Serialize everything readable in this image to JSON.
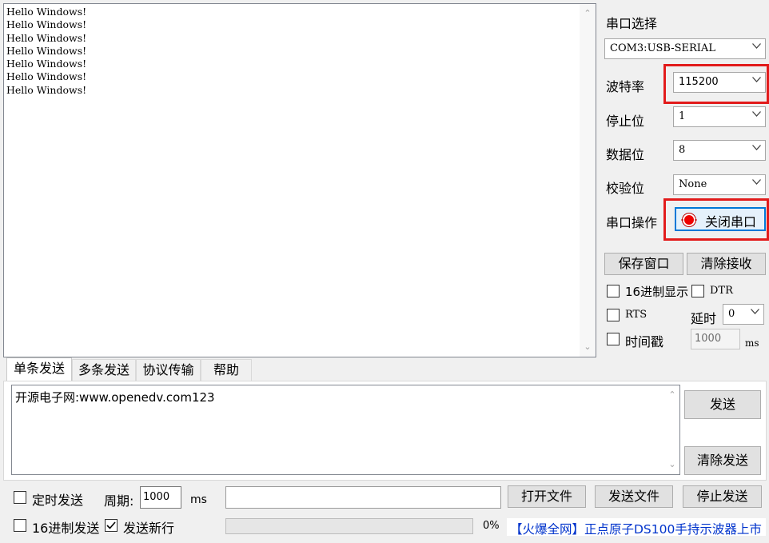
{
  "receive": {
    "lines": [
      "Hello Windows!",
      "Hello Windows!",
      "Hello Windows!",
      "Hello Windows!",
      "Hello Windows!",
      "Hello Windows!",
      "Hello Windows!"
    ]
  },
  "serial": {
    "port_label": "串口选择",
    "port_value": "COM3:USB-SERIAL",
    "baud_label": "波特率",
    "baud_value": "115200",
    "stop_label": "停止位",
    "stop_value": "1",
    "data_label": "数据位",
    "data_value": "8",
    "parity_label": "校验位",
    "parity_value": "None",
    "op_label": "串口操作",
    "op_button": "关闭串口",
    "save_window": "保存窗口",
    "clear_receive": "清除接收",
    "hex_display": "16进制显示",
    "dtr": "DTR",
    "rts": "RTS",
    "delay_label": "延时",
    "delay_value": "0",
    "timestamp": "时间戳",
    "timestamp_value": "1000",
    "ms_unit": "ms"
  },
  "tabs": [
    "单条发送",
    "多条发送",
    "协议传输",
    "帮助"
  ],
  "send": {
    "text": "开源电子网:www.openedv.com123",
    "send_button": "发送",
    "clear_send": "清除发送",
    "timed_send": "定时发送",
    "period_label": "周期:",
    "period_value": "1000",
    "ms_unit": "ms",
    "open_file": "打开文件",
    "send_file": "发送文件",
    "stop_send": "停止发送",
    "hex_send": "16进制发送",
    "send_newline": "发送新行",
    "progress_text": "0%",
    "progress": 0,
    "ad_text": "【火爆全网】正点原子DS100手持示波器上市"
  },
  "colors": {
    "highlight_border": "#e21b1b",
    "ad_text": "#0033cc",
    "active_button_border": "#0078d7"
  }
}
